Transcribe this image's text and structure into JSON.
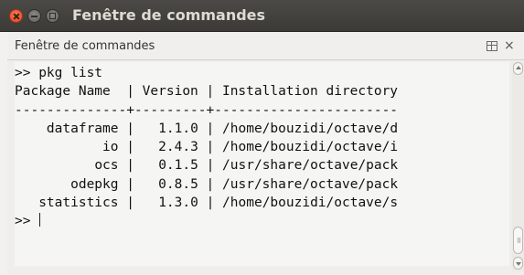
{
  "window": {
    "title": "Fenêtre de commandes"
  },
  "panel": {
    "title": "Fenêtre de commandes",
    "undock_icon": "undock-icon",
    "close_icon": "close-icon",
    "close_glyph": "×"
  },
  "console": {
    "command_line": ">> pkg list",
    "table_header": "Package Name  | Version | Installation directory",
    "separator": "--------------+---------+-----------------------",
    "packages": [
      {
        "name": "dataframe",
        "version": "1.1.0",
        "directory": "/home/bouzidi/octave/d"
      },
      {
        "name": "io",
        "version": "2.4.3",
        "directory": "/home/bouzidi/octave/i"
      },
      {
        "name": "ocs",
        "version": "0.1.5",
        "directory": "/usr/share/octave/pack"
      },
      {
        "name": "odepkg",
        "version": "0.8.5",
        "directory": "/usr/share/octave/pack"
      },
      {
        "name": "statistics",
        "version": "1.3.0",
        "directory": "/home/bouzidi/octave/s"
      }
    ],
    "prompt": ">> "
  },
  "colors": {
    "titlebar": "#3c3b37",
    "close_button": "#e9541e",
    "console_background": "#f5f5f3",
    "text": "#111111"
  }
}
